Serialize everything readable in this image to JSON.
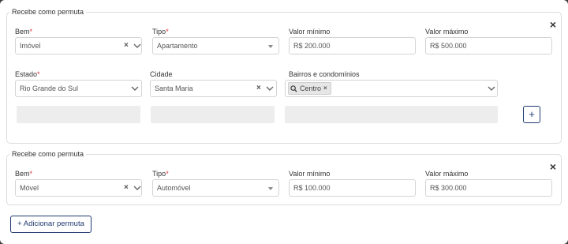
{
  "blocks": [
    {
      "legend": "Recebe como permuta",
      "close": "×",
      "fields": {
        "bem": {
          "label": "Bem",
          "value": "Imóvel"
        },
        "tipo": {
          "label": "Tipo",
          "value": "Apartamento"
        },
        "valor_min": {
          "label": "Valor mínimo",
          "value": "R$ 200.000"
        },
        "valor_max": {
          "label": "Valor máximo",
          "value": "R$ 500.000"
        },
        "estado": {
          "label": "Estado",
          "value": "Rio Grande do Sul"
        },
        "cidade": {
          "label": "Cidade",
          "value": "Santa Maria"
        },
        "bairros": {
          "label": "Bairros e condomínios",
          "tag": "Centro"
        }
      },
      "add_symbol": "+"
    },
    {
      "legend": "Recebe como permuta",
      "close": "×",
      "fields": {
        "bem": {
          "label": "Bem",
          "value": "Móvel"
        },
        "tipo": {
          "label": "Tipo",
          "value": "Automóvel"
        },
        "valor_min": {
          "label": "Valor mínimo",
          "value": "R$ 100.000"
        },
        "valor_max": {
          "label": "Valor máximo",
          "value": "R$ 300.000"
        }
      }
    }
  ],
  "required_mark": "*",
  "clear_glyph": "×",
  "add_button": "+ Adicionar permuta",
  "colors": {
    "required": "#e0303a",
    "primary": "#1e3a6e",
    "border": "#d4d4d4"
  },
  "icons": {
    "chevron": "chevron-down-icon",
    "caret": "caret-down-icon",
    "search": "magnifier-icon"
  }
}
